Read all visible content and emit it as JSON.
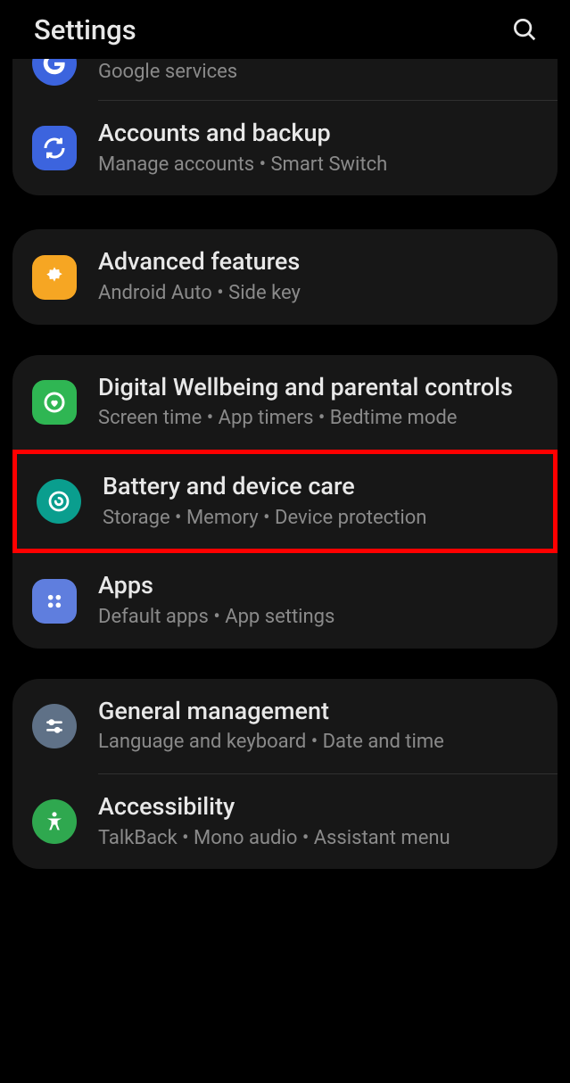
{
  "header": {
    "title": "Settings"
  },
  "groups": [
    {
      "items": [
        {
          "title_cut": "Google",
          "subtitle": "Google services"
        },
        {
          "title": "Accounts and backup",
          "subtitle": "Manage accounts  •  Smart Switch"
        }
      ]
    },
    {
      "items": [
        {
          "title": "Advanced features",
          "subtitle": "Android Auto  •  Side key"
        }
      ]
    },
    {
      "items": [
        {
          "title": "Digital Wellbeing and parental controls",
          "subtitle": "Screen time  •  App timers  •  Bedtime mode"
        },
        {
          "title": "Battery and device care",
          "subtitle": "Storage  •  Memory  •  Device protection"
        },
        {
          "title": "Apps",
          "subtitle": "Default apps  •  App settings"
        }
      ]
    },
    {
      "items": [
        {
          "title": "General management",
          "subtitle": "Language and keyboard  •  Date and time"
        },
        {
          "title": "Accessibility",
          "subtitle": "TalkBack  •  Mono audio  •  Assistant menu"
        }
      ]
    }
  ]
}
